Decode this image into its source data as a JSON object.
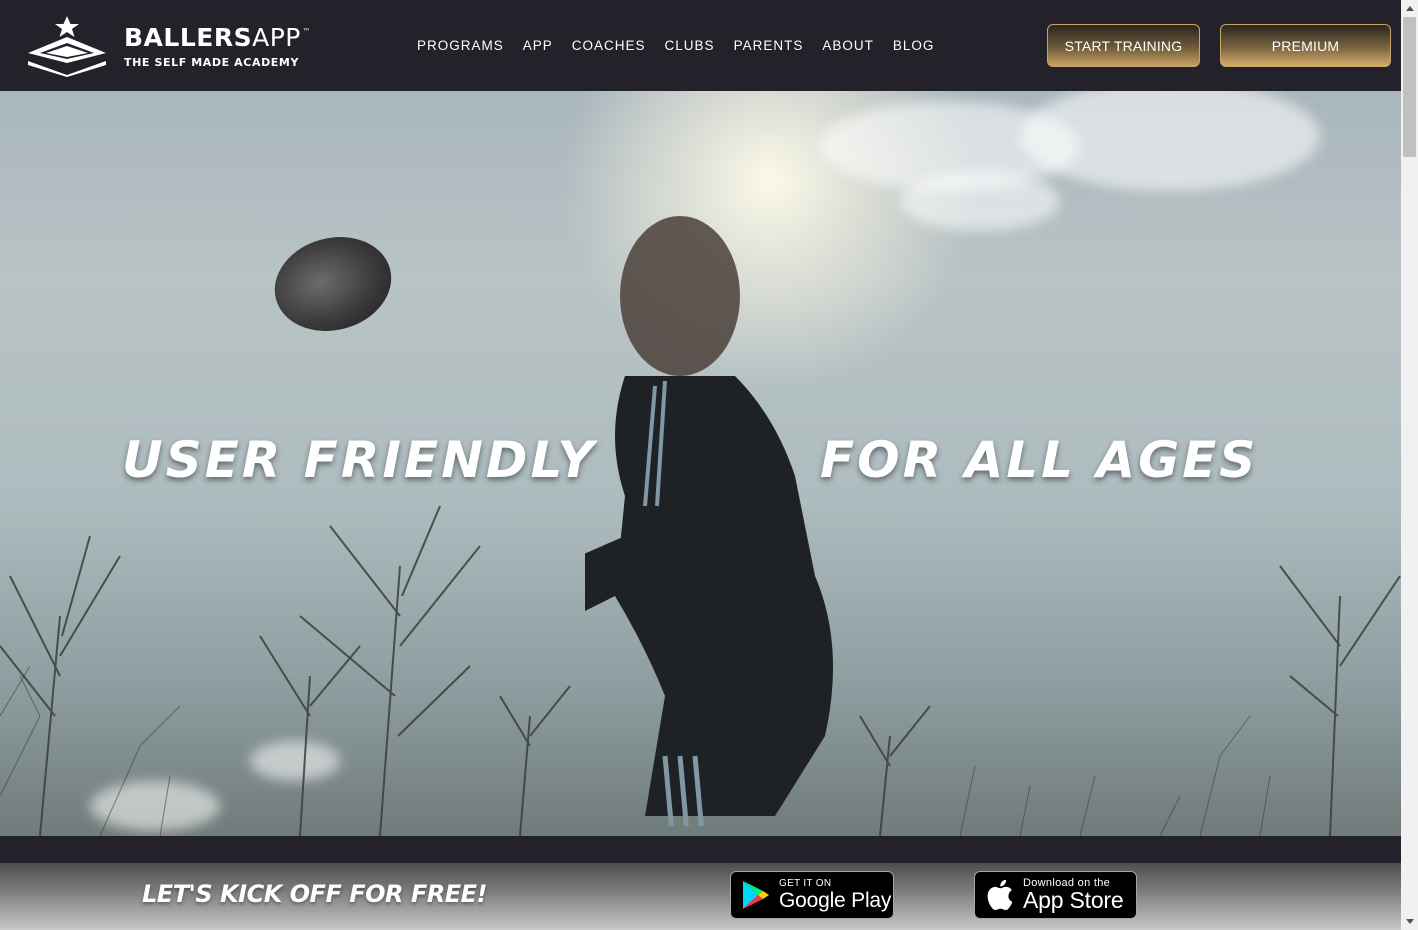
{
  "header": {
    "logo": {
      "brand_bold": "BALLERS",
      "brand_light": "APP",
      "tm": "™",
      "tagline": "THE SELF MADE ACADEMY"
    },
    "nav": [
      {
        "label": "PROGRAMS"
      },
      {
        "label": "APP"
      },
      {
        "label": "COACHES"
      },
      {
        "label": "CLUBS"
      },
      {
        "label": "PARENTS"
      },
      {
        "label": "ABOUT"
      },
      {
        "label": "BLOG"
      }
    ],
    "buttons": {
      "start_training": "START TRAINING",
      "premium": "PREMIUM"
    }
  },
  "hero": {
    "left_text": "USER FRIENDLY",
    "right_text": "FOR ALL AGES"
  },
  "cta": {
    "text": "LET'S KICK OFF FOR FREE!",
    "google_play": {
      "small": "GET IT ON",
      "big": "Google Play",
      "icon": "google-play-icon"
    },
    "app_store": {
      "small": "Download on the",
      "big": "App Store",
      "icon": "apple-icon"
    }
  },
  "colors": {
    "header_bg": "#23222a",
    "gold_accent": "#c9a56a"
  }
}
